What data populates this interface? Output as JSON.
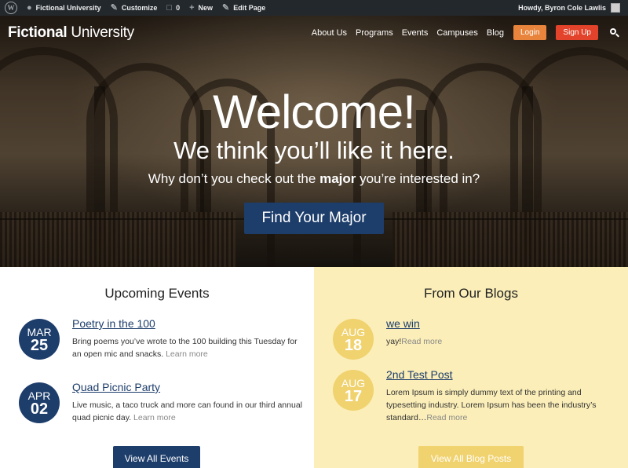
{
  "admin_bar": {
    "wp_logo": "W",
    "site_name": "Fictional University",
    "customize": "Customize",
    "comments_count": "0",
    "new": "New",
    "edit_page": "Edit Page",
    "howdy": "Howdy, Byron Cole Lawlis"
  },
  "header": {
    "logo_bold": "Fictional",
    "logo_light": " University",
    "nav": [
      "About Us",
      "Programs",
      "Events",
      "Campuses",
      "Blog"
    ],
    "login": "Login",
    "signup": "Sign Up"
  },
  "hero": {
    "welcome": "Welcome!",
    "subtitle": "We think you’ll like it here.",
    "why_pre": "Why don’t you check out the ",
    "why_bold": "major",
    "why_post": " you’re interested in?",
    "button": "Find Your Major"
  },
  "events": {
    "title": "Upcoming Events",
    "items": [
      {
        "month": "MAR",
        "day": "25",
        "title": "Poetry in the 100",
        "body": "Bring poems you’ve wrote to the 100 building this Tuesday for an open mic and snacks.",
        "more": "Learn more"
      },
      {
        "month": "APR",
        "day": "02",
        "title": "Quad Picnic Party",
        "body": "Live music, a taco truck and more can found in our third annual quad picnic day.",
        "more": "Learn more"
      }
    ],
    "button": "View All Events"
  },
  "blogs": {
    "title": "From Our Blogs",
    "items": [
      {
        "month": "AUG",
        "day": "18",
        "title": "we win",
        "body": "yay!",
        "more": "Read more"
      },
      {
        "month": "AUG",
        "day": "17",
        "title": "2nd Test Post",
        "body": "Lorem Ipsum is simply dummy text of the printing and typesetting industry. Lorem Ipsum has been the industry’s standard…",
        "more": "Read more"
      }
    ],
    "button": "View All Blog Posts"
  },
  "colors": {
    "admin_bar": "#23282d",
    "navy": "#1d3d6b",
    "gold": "#f0d26e",
    "blog_bg": "#fbeeb8",
    "login": "#e8843c",
    "signup": "#e2432a"
  }
}
